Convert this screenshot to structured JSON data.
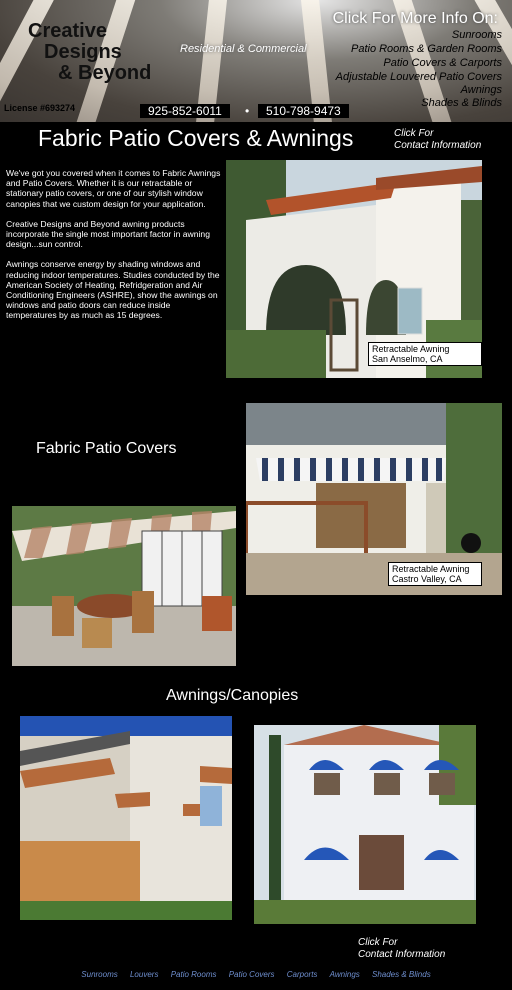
{
  "header": {
    "logo_lines": [
      "Creative",
      "Designs",
      "& Beyond"
    ],
    "license": "License #693274",
    "tagline": "Residential & Commercial",
    "phones": [
      "925-852-6011",
      "510-798-9473"
    ],
    "phone_separator": "•",
    "more_info_title": "Click For More Info On:",
    "info_links": [
      "Sunrooms",
      "Patio Rooms & Garden Rooms",
      "Patio Covers & Carports",
      "Adjustable Louvered Patio Covers",
      "Awnings",
      "Shades & Blinds"
    ]
  },
  "main": {
    "title": "Fabric Patio Covers & Awnings",
    "contact_top": [
      "Click For",
      "Contact Information"
    ],
    "intro_paragraphs": [
      "We've got you covered when it comes to Fabric Awnings and Patio Covers. Whether it is our retractable or stationary patio covers, or one of our stylish window canopies that we custom design for your application.",
      "Creative Designs and Beyond awning products incorporate the single most important factor in awning design...sun control.",
      "Awnings conserve energy by shading windows and reducing indoor temperatures. Studies conducted by the American Society of Heating, Refridgeration and Air Conditioning Engineers (ASHRE), show the awnings on windows and patio doors can reduce inside temperatures by as much as 15 degrees."
    ],
    "photo1_caption": [
      "Retractable Awning",
      "San Anselmo, CA"
    ],
    "section_patio_covers": "Fabric Patio Covers",
    "photo2_caption": [
      "Retractable Awning",
      "Castro Valley, CA"
    ],
    "section_awnings": "Awnings/Canopies",
    "contact_bottom": [
      "Click For",
      "Contact Information"
    ]
  },
  "footer": {
    "nav": [
      "Sunrooms",
      "Louvers",
      "Patio Rooms",
      "Patio Covers",
      "Carports",
      "Awnings",
      "Shades & Blinds"
    ]
  },
  "colors": {
    "background": "#000000",
    "footer_link": "#6f8fcf"
  }
}
